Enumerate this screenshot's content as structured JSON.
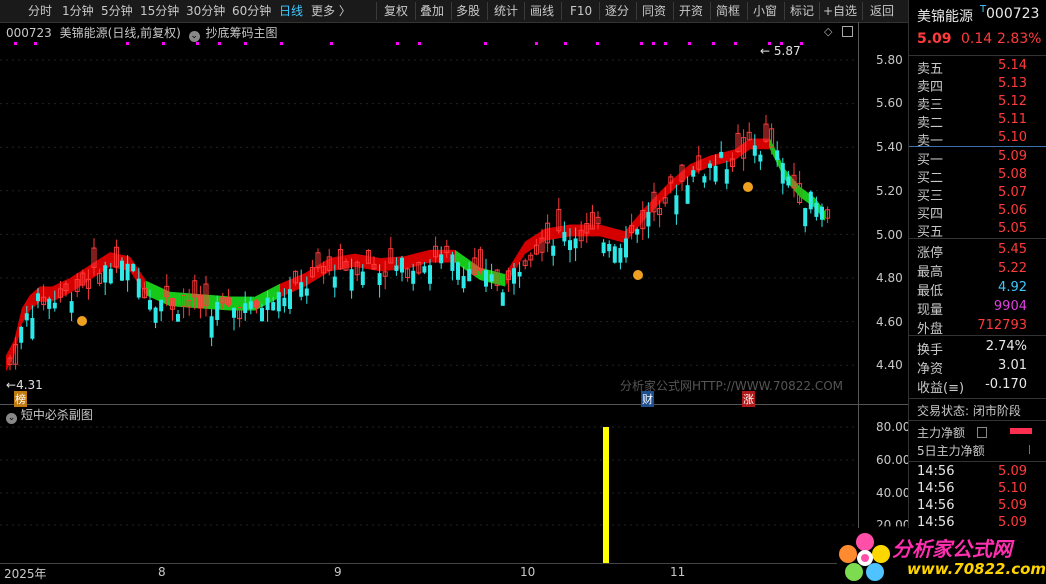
{
  "toolbar": {
    "periods": [
      "分时",
      "1分钟",
      "5分钟",
      "15分钟",
      "30分钟",
      "60分钟",
      "日线",
      "更多 〉"
    ],
    "active_period": "日线",
    "buttons": [
      "复权",
      "叠加",
      "多股",
      "统计",
      "画线",
      "F10",
      "逐分",
      "同资",
      "开资",
      "简框",
      "小窗",
      "标记",
      "+自选",
      "返回"
    ]
  },
  "chart_header": {
    "code": "000723",
    "name": "美锦能源(日线,前复权)",
    "indicator": "抄底筹码主图"
  },
  "main_chart": {
    "high_marker": "5.87",
    "low_marker": "4.31",
    "watermark": "分析家公式网HTTP://WWW.70822.COM",
    "badges": [
      "榜",
      "财",
      "涨"
    ],
    "y_ticks": [
      "5.80",
      "5.60",
      "5.40",
      "5.20",
      "5.00",
      "4.80",
      "4.60",
      "4.40"
    ]
  },
  "sub_chart": {
    "title": "短中必杀副图",
    "y_ticks": [
      "80.00",
      "60.00",
      "40.00",
      "20.00"
    ],
    "bar_value": 80
  },
  "x_axis": [
    "2025年",
    "8",
    "9",
    "10",
    "11"
  ],
  "quote": {
    "name": "美锦能源",
    "code": "000723",
    "price": "5.09",
    "change": "0.14",
    "change_pct": "2.83%",
    "asks": [
      {
        "label": "卖五",
        "price": "5.14"
      },
      {
        "label": "卖四",
        "price": "5.13"
      },
      {
        "label": "卖三",
        "price": "5.12"
      },
      {
        "label": "卖二",
        "price": "5.11"
      },
      {
        "label": "卖一",
        "price": "5.10"
      }
    ],
    "bids": [
      {
        "label": "买一",
        "price": "5.09"
      },
      {
        "label": "买二",
        "price": "5.08"
      },
      {
        "label": "买三",
        "price": "5.07"
      },
      {
        "label": "买四",
        "price": "5.06"
      },
      {
        "label": "买五",
        "price": "5.05"
      }
    ],
    "stats": [
      {
        "label": "涨停",
        "value": "5.45",
        "color": "red"
      },
      {
        "label": "最高",
        "value": "5.22",
        "color": "red"
      },
      {
        "label": "最低",
        "value": "4.92",
        "color": "blue"
      },
      {
        "label": "现量",
        "value": "9904",
        "color": "mag"
      },
      {
        "label": "外盘",
        "value": "712793",
        "color": "red"
      }
    ],
    "stats2": [
      {
        "label": "换手",
        "value": "2.74%"
      },
      {
        "label": "净资",
        "value": "3.01"
      },
      {
        "label": "收益(≡)",
        "value": "-0.170"
      }
    ],
    "trade_status": "交易状态: 闭市阶段",
    "main_net": "主力净额",
    "main_net_5d": "5日主力净额",
    "ticks": [
      {
        "time": "14:56",
        "price": "5.09"
      },
      {
        "time": "14:56",
        "price": "5.10"
      },
      {
        "time": "14:56",
        "price": "5.09"
      },
      {
        "time": "14:56",
        "price": "5.09"
      }
    ]
  },
  "logo": {
    "text": "分析家公式网",
    "url": "www.70822.com"
  }
}
